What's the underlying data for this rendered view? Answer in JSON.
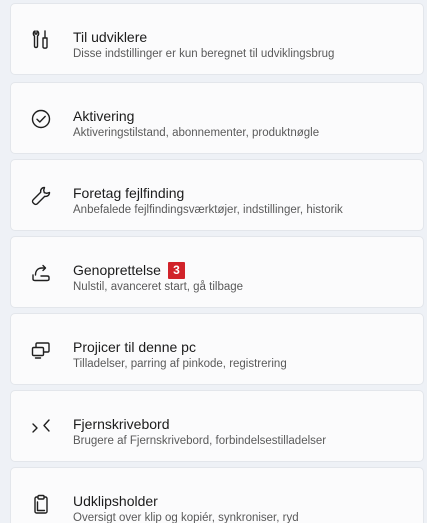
{
  "settings_items": [
    {
      "icon": "tools-icon",
      "title": "Til udviklere",
      "subtitle": "Disse indstillinger er kun beregnet til udviklingsbrug"
    },
    {
      "icon": "check-circle-icon",
      "title": "Aktivering",
      "subtitle": "Aktiveringstilstand, abonnementer, produktnøgle"
    },
    {
      "icon": "wrench-icon",
      "title": "Foretag fejlfinding",
      "subtitle": "Anbefalede fejlfindingsværktøjer, indstillinger, historik"
    },
    {
      "icon": "recovery-icon",
      "title": "Genoprettelse",
      "badge": "3",
      "badge_color": "#d1232a",
      "subtitle": "Nulstil, avanceret start, gå tilbage"
    },
    {
      "icon": "project-to-pc-icon",
      "title": "Projicer til denne pc",
      "subtitle": "Tilladelser, parring af pinkode, registrering"
    },
    {
      "icon": "remote-desktop-icon",
      "title": "Fjernskrivebord",
      "subtitle": "Brugere af Fjernskrivebord, forbindelsestilladelser"
    },
    {
      "icon": "clipboard-icon",
      "title": "Udklipsholder",
      "subtitle": "Oversigt over klip og kopiér, synkroniser, ryd"
    }
  ]
}
